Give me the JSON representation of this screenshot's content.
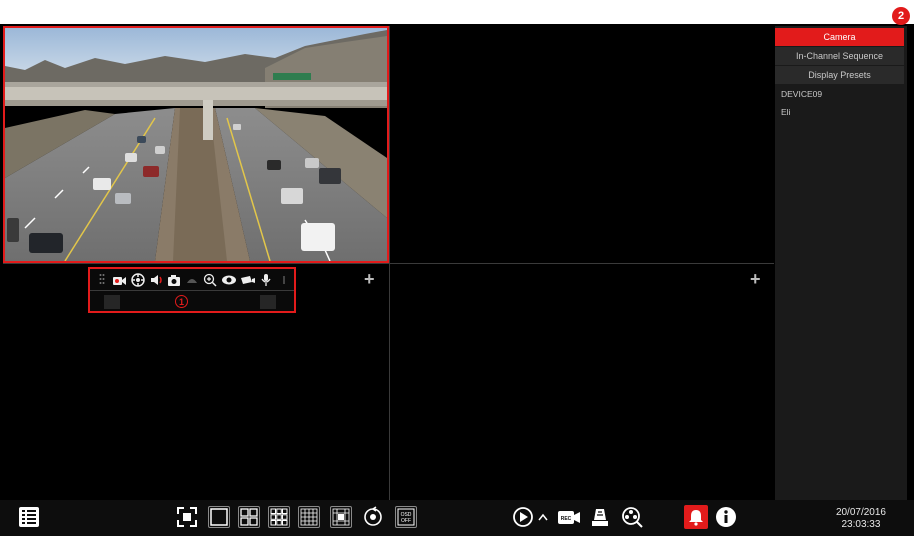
{
  "callouts": {
    "toolbar": "1",
    "panel": "2"
  },
  "colors": {
    "accent": "#e21b1b",
    "panel_bg": "#1a1a1a",
    "tab_bg": "#2a2a2a",
    "bar_bg": "#0d0d0d"
  },
  "grid": {
    "layout": "2x2",
    "cells": [
      {
        "name": "channel-1",
        "content": "highway-camera-feed",
        "selected": true
      },
      {
        "name": "channel-2",
        "content": "empty"
      },
      {
        "name": "channel-3",
        "content": "empty"
      },
      {
        "name": "channel-4",
        "content": "empty"
      }
    ]
  },
  "camera_toolbar": {
    "icons": [
      "drag-handle-icon",
      "record-icon",
      "ptz-icon",
      "audio-icon",
      "snapshot-icon",
      "color-icon",
      "zoom-icon",
      "live-view-icon",
      "camera-switch-icon",
      "microphone-icon",
      "more-icon"
    ]
  },
  "side_panel": {
    "tabs": [
      {
        "label": "Camera",
        "active": true
      },
      {
        "label": "In-Channel Sequence",
        "active": false
      },
      {
        "label": "Display Presets",
        "active": false
      }
    ],
    "devices": [
      "DEVICE09",
      "Eli"
    ]
  },
  "taskbar": {
    "left": [
      "menu-icon"
    ],
    "layouts": [
      "fullscreen-icon",
      "layout-1-icon",
      "layout-4-icon",
      "layout-9-icon",
      "layout-16-icon",
      "layout-custom-icon",
      "sequence-icon",
      "osd-icon"
    ],
    "center": [
      "playback-icon",
      "chevron-up-icon",
      "record-icon",
      "manual-alarm-icon",
      "ptz-icon"
    ],
    "right": [
      "alarm-bell-icon",
      "info-icon"
    ],
    "osd_label": "OSD OFF",
    "date": "20/07/2016",
    "time": "23:03:33"
  }
}
